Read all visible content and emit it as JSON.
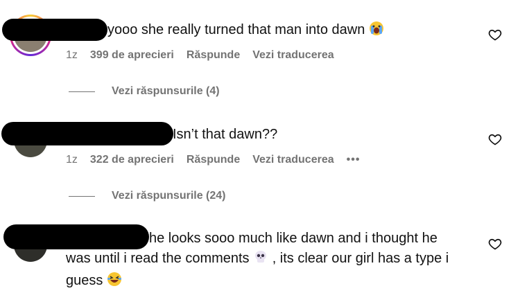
{
  "comments": [
    {
      "text": "yooo she really turned that man into dawn",
      "emoji": "crying",
      "time": "1z",
      "likes": "399 de aprecieri",
      "reply": "Răspunde",
      "translate": "Vezi traducerea",
      "replies": "Vezi răspunsurile (4)"
    },
    {
      "text": "Isn’t that dawn??",
      "time": "1z",
      "likes": "322 de aprecieri",
      "reply": "Răspunde",
      "translate": "Vezi traducerea",
      "more": "•••",
      "replies": "Vezi răspunsurile (24)"
    },
    {
      "text_line1": "he looks sooo much like dawn and i thought he",
      "text_line2a": "was until i read the comments",
      "text_line2b": ", its clear our girl has a type i",
      "text_line3": "guess",
      "emoji_a": "skull",
      "emoji_b": "laughing"
    }
  ],
  "colors": {
    "meta": "#737373",
    "text": "#111111",
    "redaction": "#000000"
  },
  "icons": [
    "heart-icon",
    "crying-emoji-icon",
    "skull-emoji-icon",
    "laughing-emoji-icon",
    "more-icon"
  ]
}
